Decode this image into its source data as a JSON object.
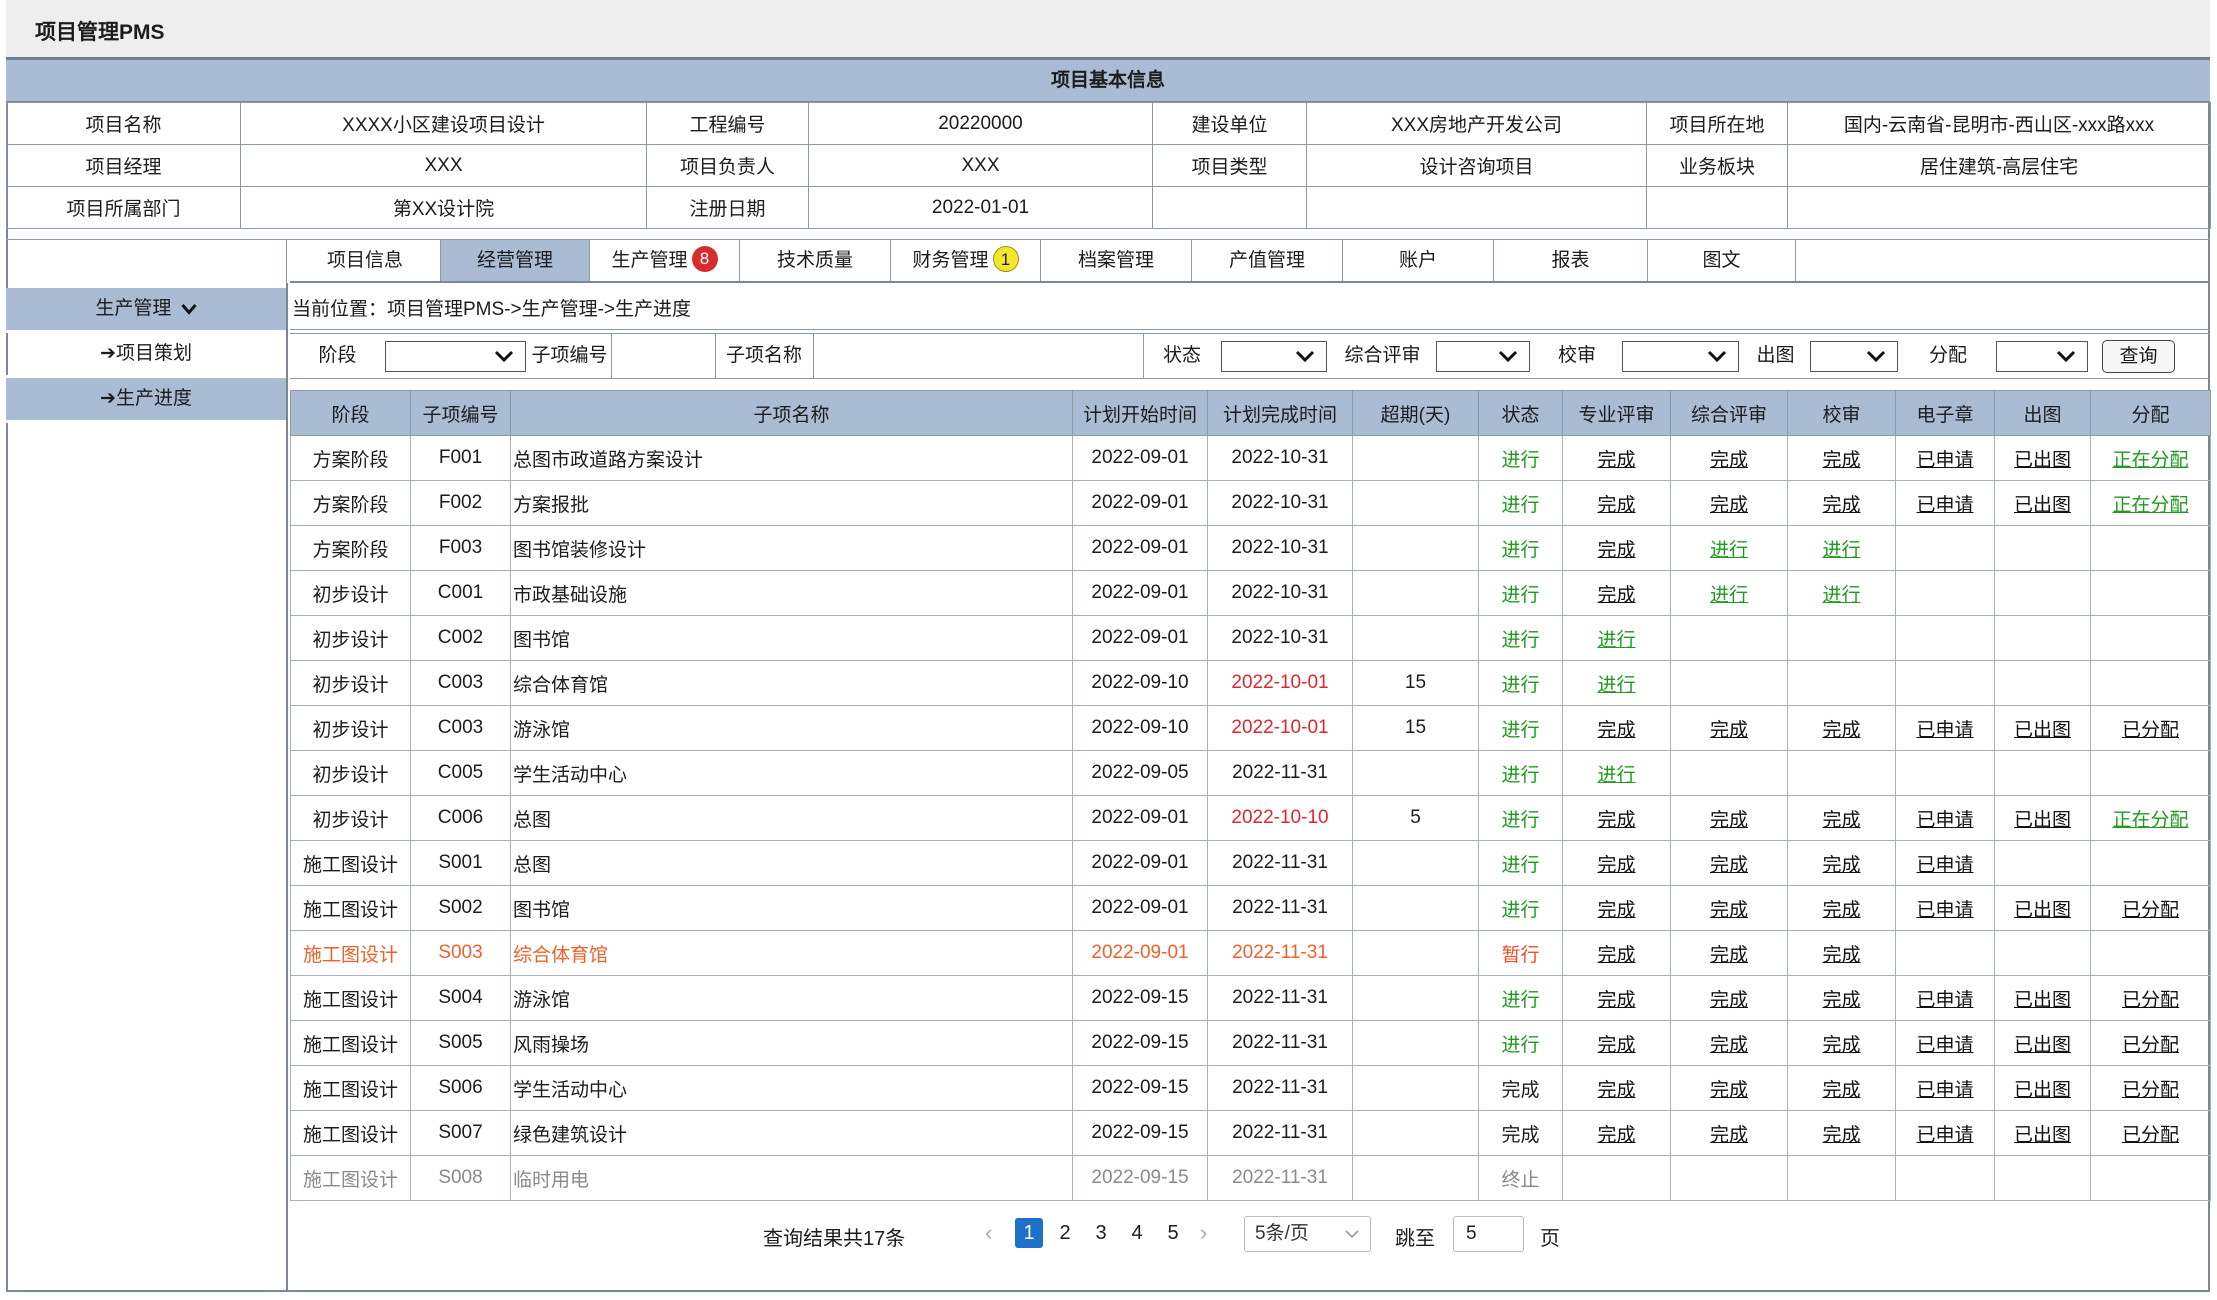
{
  "app": {
    "title": "项目管理PMS"
  },
  "info": {
    "header": "项目基本信息",
    "rows": [
      [
        "项目名称",
        "XXXX小区建设项目设计",
        "工程编号",
        "20220000",
        "建设单位",
        "XXX房地产开发公司",
        "项目所在地",
        "国内-云南省-昆明市-西山区-xxx路xxx"
      ],
      [
        "项目经理",
        "XXX",
        "项目负责人",
        "XXX",
        "项目类型",
        "设计咨询项目",
        "业务板块",
        "居住建筑-高层住宅"
      ],
      [
        "项目所属部门",
        "第XX设计院",
        "注册日期",
        "2022-01-01",
        "",
        "",
        "",
        ""
      ]
    ]
  },
  "tabs": [
    {
      "label": "项目信息"
    },
    {
      "label": "经营管理",
      "active": true
    },
    {
      "label": "生产管理",
      "badge": "8",
      "badge_color": "red"
    },
    {
      "label": "技术质量"
    },
    {
      "label": "财务管理",
      "badge": "1",
      "badge_color": "yellow"
    },
    {
      "label": "档案管理"
    },
    {
      "label": "产值管理"
    },
    {
      "label": "账户"
    },
    {
      "label": "报表"
    },
    {
      "label": "图文"
    }
  ],
  "nav": {
    "group": "生产管理",
    "items": [
      {
        "label": "➔项目策划",
        "active": false
      },
      {
        "label": "➔生产进度",
        "active": true
      }
    ]
  },
  "breadcrumb": "当前位置：项目管理PMS->生产管理->生产进度",
  "filters": {
    "stage_label": "阶段",
    "code_label": "子项编号",
    "name_label": "子项名称",
    "status_label": "状态",
    "review_label": "综合评审",
    "check_label": "校审",
    "drawing_label": "出图",
    "assign_label": "分配",
    "query_button": "查询"
  },
  "table": {
    "columns": [
      "阶段",
      "子项编号",
      "子项名称",
      "计划开始时间",
      "计划完成时间",
      "超期(天)",
      "状态",
      "专业评审",
      "综合评审",
      "校审",
      "电子章",
      "出图",
      "分配"
    ],
    "rows": [
      {
        "stage": "方案阶段",
        "code": "F001",
        "name": "总图市政道路方案设计",
        "start": "2022-09-01",
        "end": "2022-10-31",
        "overdue": "",
        "status": "进行",
        "status_tone": "green",
        "links": [
          [
            "完成",
            "k"
          ],
          [
            "完成",
            "k"
          ],
          [
            "完成",
            "k"
          ],
          [
            "已申请",
            "k"
          ],
          [
            "已出图",
            "k"
          ],
          [
            "正在分配",
            "g"
          ]
        ]
      },
      {
        "stage": "方案阶段",
        "code": "F002",
        "name": "方案报批",
        "start": "2022-09-01",
        "end": "2022-10-31",
        "overdue": "",
        "status": "进行",
        "status_tone": "green",
        "links": [
          [
            "完成",
            "k"
          ],
          [
            "完成",
            "k"
          ],
          [
            "完成",
            "k"
          ],
          [
            "已申请",
            "k"
          ],
          [
            "已出图",
            "k"
          ],
          [
            "正在分配",
            "g"
          ]
        ]
      },
      {
        "stage": "方案阶段",
        "code": "F003",
        "name": "图书馆装修设计",
        "start": "2022-09-01",
        "end": "2022-10-31",
        "overdue": "",
        "status": "进行",
        "status_tone": "green",
        "links": [
          [
            "完成",
            "k"
          ],
          [
            "进行",
            "g"
          ],
          [
            "进行",
            "g"
          ],
          [
            "",
            ""
          ],
          [
            "",
            ""
          ],
          [
            "",
            ""
          ]
        ]
      },
      {
        "stage": "初步设计",
        "code": "C001",
        "name": "市政基础设施",
        "start": "2022-09-01",
        "end": "2022-10-31",
        "overdue": "",
        "status": "进行",
        "status_tone": "green",
        "links": [
          [
            "完成",
            "k"
          ],
          [
            "进行",
            "g"
          ],
          [
            "进行",
            "g"
          ],
          [
            "",
            ""
          ],
          [
            "",
            ""
          ],
          [
            "",
            ""
          ]
        ]
      },
      {
        "stage": "初步设计",
        "code": "C002",
        "name": "图书馆",
        "start": "2022-09-01",
        "end": "2022-10-31",
        "overdue": "",
        "status": "进行",
        "status_tone": "green",
        "links": [
          [
            "进行",
            "g"
          ],
          [
            "",
            ""
          ],
          [
            "",
            ""
          ],
          [
            "",
            ""
          ],
          [
            "",
            ""
          ],
          [
            "",
            ""
          ]
        ]
      },
      {
        "stage": "初步设计",
        "code": "C003",
        "name": "综合体育馆",
        "start": "2022-09-10",
        "end": "2022-10-01",
        "end_late": true,
        "overdue": "15",
        "status": "进行",
        "status_tone": "green",
        "links": [
          [
            "进行",
            "g"
          ],
          [
            "",
            ""
          ],
          [
            "",
            ""
          ],
          [
            "",
            ""
          ],
          [
            "",
            ""
          ],
          [
            "",
            ""
          ]
        ]
      },
      {
        "stage": "初步设计",
        "code": "C003",
        "name": "游泳馆",
        "start": "2022-09-10",
        "end": "2022-10-01",
        "end_late": true,
        "overdue": "15",
        "status": "进行",
        "status_tone": "green",
        "links": [
          [
            "完成",
            "k"
          ],
          [
            "完成",
            "k"
          ],
          [
            "完成",
            "k"
          ],
          [
            "已申请",
            "k"
          ],
          [
            "已出图",
            "k"
          ],
          [
            "已分配",
            "k"
          ]
        ]
      },
      {
        "stage": "初步设计",
        "code": "C005",
        "name": "学生活动中心",
        "start": "2022-09-05",
        "end": "2022-11-31",
        "overdue": "",
        "status": "进行",
        "status_tone": "green",
        "links": [
          [
            "进行",
            "g"
          ],
          [
            "",
            ""
          ],
          [
            "",
            ""
          ],
          [
            "",
            ""
          ],
          [
            "",
            ""
          ],
          [
            "",
            ""
          ]
        ]
      },
      {
        "stage": "初步设计",
        "code": "C006",
        "name": "总图",
        "start": "2022-09-01",
        "end": "2022-10-10",
        "end_late": true,
        "overdue": "5",
        "status": "进行",
        "status_tone": "green",
        "links": [
          [
            "完成",
            "k"
          ],
          [
            "完成",
            "k"
          ],
          [
            "完成",
            "k"
          ],
          [
            "已申请",
            "k"
          ],
          [
            "已出图",
            "k"
          ],
          [
            "正在分配",
            "g"
          ]
        ]
      },
      {
        "stage": "施工图设计",
        "code": "S001",
        "name": "总图",
        "start": "2022-09-01",
        "end": "2022-11-31",
        "overdue": "",
        "status": "进行",
        "status_tone": "green",
        "links": [
          [
            "完成",
            "k"
          ],
          [
            "完成",
            "k"
          ],
          [
            "完成",
            "k"
          ],
          [
            "已申请",
            "k"
          ],
          [
            "",
            ""
          ],
          [
            "",
            ""
          ]
        ]
      },
      {
        "stage": "施工图设计",
        "code": "S002",
        "name": "图书馆",
        "start": "2022-09-01",
        "end": "2022-11-31",
        "overdue": "",
        "status": "进行",
        "status_tone": "green",
        "links": [
          [
            "完成",
            "k"
          ],
          [
            "完成",
            "k"
          ],
          [
            "完成",
            "k"
          ],
          [
            "已申请",
            "k"
          ],
          [
            "已出图",
            "k"
          ],
          [
            "已分配",
            "k"
          ]
        ]
      },
      {
        "stage": "施工图设计",
        "code": "S003",
        "name": "综合体育馆",
        "start": "2022-09-01",
        "end": "2022-11-31",
        "overdue": "",
        "status": "暂行",
        "status_tone": "red",
        "row_tone": "warn",
        "links": [
          [
            "完成",
            "k"
          ],
          [
            "完成",
            "k"
          ],
          [
            "完成",
            "k"
          ],
          [
            "",
            ""
          ],
          [
            "",
            ""
          ],
          [
            "",
            ""
          ]
        ]
      },
      {
        "stage": "施工图设计",
        "code": "S004",
        "name": "游泳馆",
        "start": "2022-09-15",
        "end": "2022-11-31",
        "overdue": "",
        "status": "进行",
        "status_tone": "green",
        "links": [
          [
            "完成",
            "k"
          ],
          [
            "完成",
            "k"
          ],
          [
            "完成",
            "k"
          ],
          [
            "已申请",
            "k"
          ],
          [
            "已出图",
            "k"
          ],
          [
            "已分配",
            "k"
          ]
        ]
      },
      {
        "stage": "施工图设计",
        "code": "S005",
        "name": "风雨操场",
        "start": "2022-09-15",
        "end": "2022-11-31",
        "overdue": "",
        "status": "进行",
        "status_tone": "green",
        "links": [
          [
            "完成",
            "k"
          ],
          [
            "完成",
            "k"
          ],
          [
            "完成",
            "k"
          ],
          [
            "已申请",
            "k"
          ],
          [
            "已出图",
            "k"
          ],
          [
            "已分配",
            "k"
          ]
        ]
      },
      {
        "stage": "施工图设计",
        "code": "S006",
        "name": "学生活动中心",
        "start": "2022-09-15",
        "end": "2022-11-31",
        "overdue": "",
        "status": "完成",
        "status_tone": "black",
        "links": [
          [
            "完成",
            "k"
          ],
          [
            "完成",
            "k"
          ],
          [
            "完成",
            "k"
          ],
          [
            "已申请",
            "k"
          ],
          [
            "已出图",
            "k"
          ],
          [
            "已分配",
            "k"
          ]
        ]
      },
      {
        "stage": "施工图设计",
        "code": "S007",
        "name": "绿色建筑设计",
        "start": "2022-09-15",
        "end": "2022-11-31",
        "overdue": "",
        "status": "完成",
        "status_tone": "black",
        "links": [
          [
            "完成",
            "k"
          ],
          [
            "完成",
            "k"
          ],
          [
            "完成",
            "k"
          ],
          [
            "已申请",
            "k"
          ],
          [
            "已出图",
            "k"
          ],
          [
            "已分配",
            "k"
          ]
        ]
      },
      {
        "stage": "施工图设计",
        "code": "S008",
        "name": "临时用电",
        "start": "2022-09-15",
        "end": "2022-11-31",
        "overdue": "",
        "status": "终止",
        "status_tone": "gray",
        "row_tone": "gray",
        "links": [
          [
            "",
            ""
          ],
          [
            "",
            ""
          ],
          [
            "",
            ""
          ],
          [
            "",
            ""
          ],
          [
            "",
            ""
          ],
          [
            "",
            ""
          ]
        ]
      }
    ]
  },
  "pagination": {
    "total_text": "查询结果共17条",
    "pages": [
      "1",
      "2",
      "3",
      "4",
      "5"
    ],
    "current": "1",
    "page_size": "5条/页",
    "jump_label": "跳至",
    "jump_value": "5",
    "page_suffix": "页"
  },
  "colors": {
    "header_bg": "#a9bcd4",
    "status_green": "#1f9a1f",
    "late_date": "#e0262d",
    "warn_row": "#f0612a",
    "pager_current": "#1e70c8"
  }
}
